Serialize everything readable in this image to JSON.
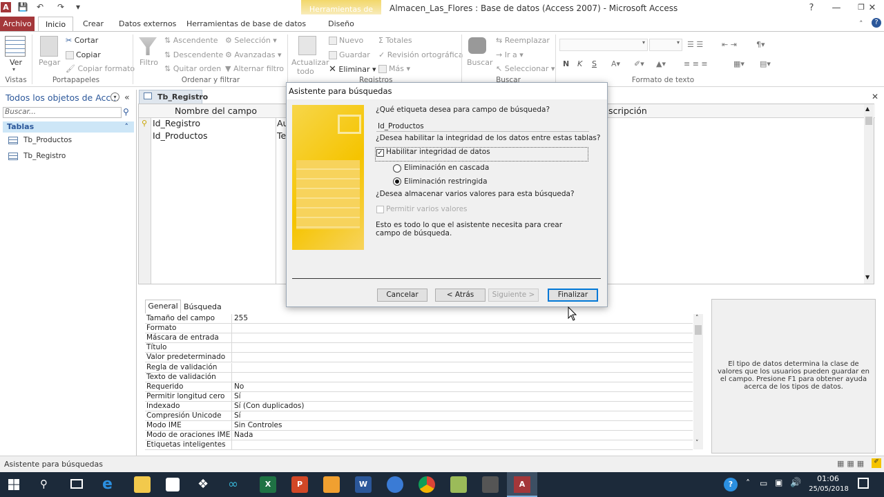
{
  "window": {
    "title": "Almacen_Las_Flores : Base de datos (Access 2007)  -  Microsoft Access",
    "contextual_group": "Herramientas de tabla",
    "contextual_tab": "Diseño"
  },
  "tabs": [
    "Archivo",
    "Inicio",
    "Crear",
    "Datos externos",
    "Herramientas de base de datos"
  ],
  "ribbon": {
    "vistas": {
      "ver": "Ver",
      "group": "Vistas"
    },
    "portapapeles": {
      "pegar": "Pegar",
      "cortar": "Cortar",
      "copiar": "Copiar",
      "copiar_formato": "Copiar formato",
      "group": "Portapapeles"
    },
    "ordenar": {
      "filtro": "Filtro",
      "ascendente": "Ascendente",
      "descendente": "Descendente",
      "quitar_orden": "Quitar orden",
      "seleccion": "Selección",
      "avanzadas": "Avanzadas",
      "alternar": "Alternar filtro",
      "group": "Ordenar y filtrar"
    },
    "registros": {
      "actualizar": "Actualizar",
      "todo": "todo",
      "nuevo": "Nuevo",
      "guardar": "Guardar",
      "eliminar": "Eliminar",
      "totales": "Totales",
      "revision": "Revisión ortográfica",
      "mas": "Más",
      "group": "Registros"
    },
    "buscar": {
      "buscar": "Buscar",
      "reemplazar": "Reemplazar",
      "ir_a": "Ir a",
      "seleccionar": "Seleccionar",
      "group": "Buscar"
    },
    "formato": {
      "bold": "N",
      "italic": "K",
      "underline": "S",
      "group": "Formato de texto"
    }
  },
  "nav": {
    "header": "Todos los objetos de Acc...",
    "search_placeholder": "Buscar...",
    "section": "Tablas",
    "items": [
      "Tb_Productos",
      "Tb_Registro"
    ]
  },
  "doc": {
    "tab": "Tb_Registro",
    "headers": {
      "field": "Nombre del campo",
      "desc": "scripción"
    },
    "rows": [
      {
        "name": "Id_Registro",
        "type": "Au"
      },
      {
        "name": "Id_Productos",
        "type": "Te"
      }
    ]
  },
  "props": {
    "tabs": [
      "General",
      "Búsqueda"
    ],
    "rows": [
      {
        "n": "Tamaño del campo",
        "v": "255"
      },
      {
        "n": "Formato",
        "v": ""
      },
      {
        "n": "Máscara de entrada",
        "v": ""
      },
      {
        "n": "Título",
        "v": ""
      },
      {
        "n": "Valor predeterminado",
        "v": ""
      },
      {
        "n": "Regla de validación",
        "v": ""
      },
      {
        "n": "Texto de validación",
        "v": ""
      },
      {
        "n": "Requerido",
        "v": "No"
      },
      {
        "n": "Permitir longitud cero",
        "v": "Sí"
      },
      {
        "n": "Indexado",
        "v": "Sí (Con duplicados)"
      },
      {
        "n": "Compresión Unicode",
        "v": "Sí"
      },
      {
        "n": "Modo IME",
        "v": "Sin Controles"
      },
      {
        "n": "Modo de oraciones IME",
        "v": "Nada"
      },
      {
        "n": "Etiquetas inteligentes",
        "v": ""
      }
    ],
    "help": "El tipo de datos determina la clase de valores que los usuarios pueden guardar en el campo. Presione F1 para obtener ayuda acerca de los tipos de datos."
  },
  "dialog": {
    "title": "Asistente para búsquedas",
    "q1": "¿Qué etiqueta desea para campo de búsqueda?",
    "lookup_name": "Id_Productos",
    "q2": "¿Desea habilitar la integridad de los datos entre estas tablas?",
    "enable_integrity": "Habilitar integridad de datos",
    "cascade": "Eliminación en cascada",
    "restrict": "Eliminación restringida",
    "q3": "¿Desea almacenar varios valores para esta búsqueda?",
    "multi": "Permitir varios valores",
    "final": "Esto es todo lo que el asistente necesita para crear campo de búsqueda.",
    "buttons": {
      "cancel": "Cancelar",
      "back": "< Atrás",
      "next": "Siguiente >",
      "finish": "Finalizar"
    }
  },
  "status": {
    "text": "Asistente para búsquedas"
  },
  "clock": {
    "time": "01:06",
    "date": "25/05/2018"
  }
}
